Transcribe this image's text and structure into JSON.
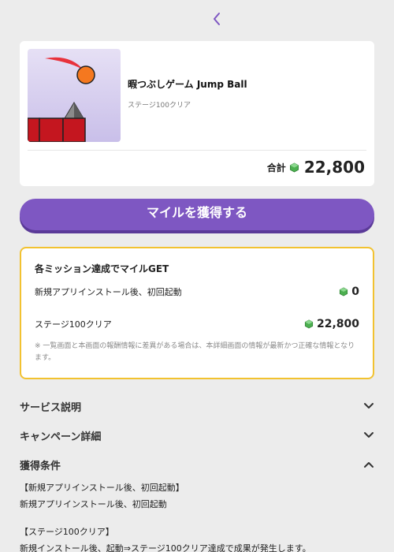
{
  "app": {
    "title": "暇つぶしゲーム Jump Ball",
    "subtitle": "ステージ100クリア",
    "total_label": "合計",
    "total_value": "22,800"
  },
  "cta": {
    "label": "マイルを獲得する"
  },
  "missions": {
    "title": "各ミッション達成でマイルGET",
    "rows": [
      {
        "label": "新規アプリインストール後、初回起動",
        "value": "0"
      },
      {
        "label": "ステージ100クリア",
        "value": "22,800"
      }
    ],
    "note": "※ 一覧画面と本画面の報酬情報に差異がある場合は、本詳細画面の情報が最新かつ正確な情報となります。"
  },
  "sections": [
    {
      "title": "サービス説明",
      "state": "collapsed"
    },
    {
      "title": "キャンペーン詳細",
      "state": "collapsed"
    },
    {
      "title": "獲得条件",
      "state": "expanded"
    }
  ],
  "conditions": [
    {
      "heading": "【新規アプリインストール後、初回起動】",
      "text": "新規アプリインストール後、初回起動"
    },
    {
      "heading": "【ステージ100クリア】",
      "text": "新規インストール後、起動⇒ステージ100クリア達成で成果が発生します。"
    }
  ],
  "icons": {
    "back": "chevron-left-icon",
    "gem": "green-gem-icon",
    "expand": "chevron-down-icon",
    "collapse": "chevron-up-icon"
  },
  "colors": {
    "accent": "#7e57c2",
    "mission_border": "#f2c230",
    "gem": "#4caf50",
    "background": "#ececec"
  }
}
